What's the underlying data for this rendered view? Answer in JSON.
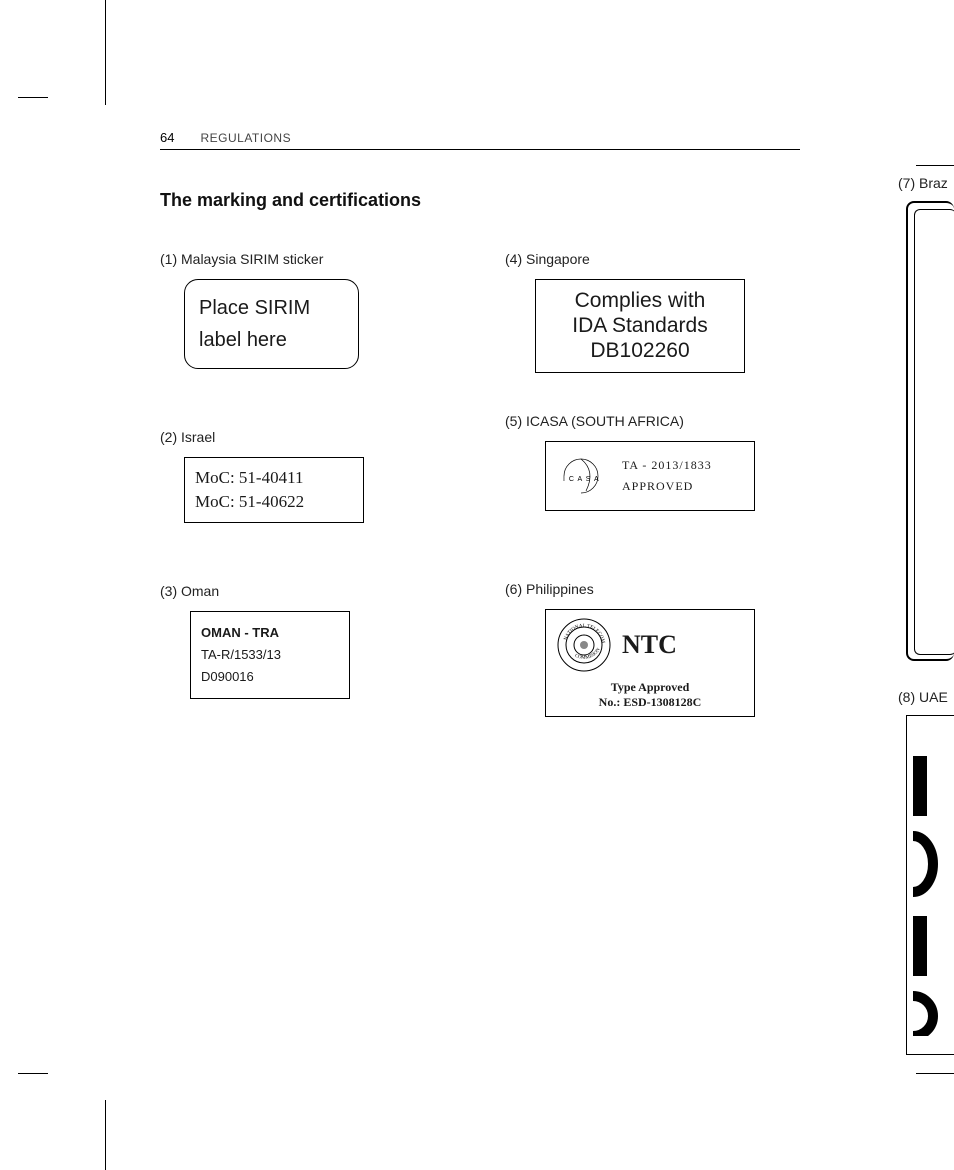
{
  "page_number": "64",
  "header_label": "REGULATIONS",
  "section_title": "The marking and certifications",
  "items": [
    {
      "caption": "(1) Malaysia SIRIM sticker",
      "sirim_line1": "Place SIRIM",
      "sirim_line2": "label here"
    },
    {
      "caption": "(2) Israel",
      "line1": "MoC: 51-40411",
      "line2": "MoC: 51-40622"
    },
    {
      "caption": "(3) Oman",
      "head": "OMAN - TRA",
      "line1": "TA-R/1533/13",
      "line2": "D090016"
    },
    {
      "caption": "(4) Singapore",
      "line1": "Complies with",
      "line2": "IDA Standards",
      "line3": "DB102260"
    },
    {
      "caption": "(5) ICASA (SOUTH AFRICA)",
      "logo_text": "ICASA",
      "line1": "TA - 2013/1833",
      "line2": "APPROVED"
    },
    {
      "caption": "(6) Philippines",
      "seal_text": "NATIONAL TELECOMMUNICATIONS COMMISION",
      "brand": "NTC",
      "line1": "Type Approved",
      "line2": "No.: ESD-1308128C"
    }
  ],
  "right_partial": [
    {
      "caption": "(7) Braz"
    },
    {
      "caption": "(8) UAE"
    }
  ]
}
